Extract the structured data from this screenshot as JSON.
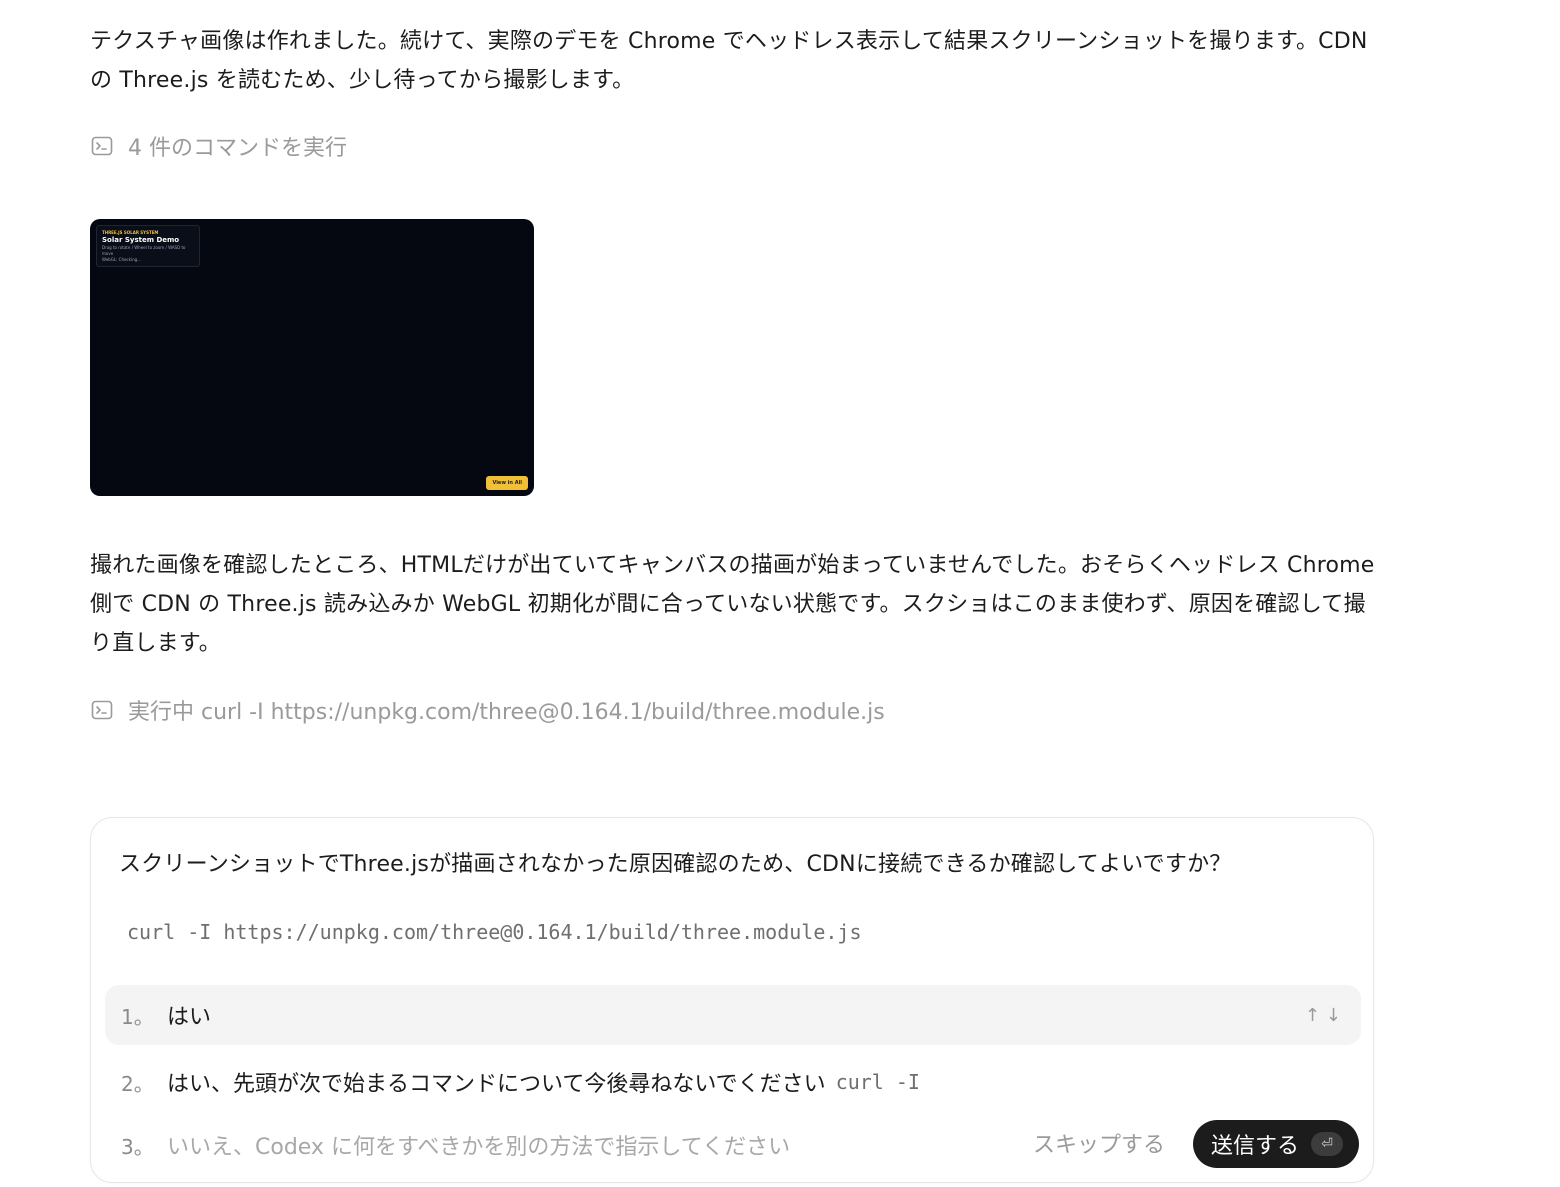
{
  "messages": {
    "para1": "テクスチャ画像は作れました。続けて、実際のデモを Chrome でヘッドレス表示して結果スクリーンショットを撮ります。CDN の Three.js を読むため、少し待ってから撮影します。",
    "command_summary": "4 件のコマンドを実行",
    "para2": "撮れた画像を確認したところ、HTMLだけが出ていてキャンバスの描画が始まっていませんでした。おそらくヘッドレス Chrome 側で CDN の Three.js 読み込みか WebGL 初期化が間に合っていない状態です。スクショはこのまま使わず、原因を確認して撮り直します。",
    "running_command": "実行中 curl -I https://unpkg.com/three@0.164.1/build/three.module.js"
  },
  "screenshot": {
    "kicker": "THREE.JS SOLAR SYSTEM",
    "title": "Solar System Demo",
    "subtitle": "Drag to rotate / Wheel to zoom / WASD to move",
    "status": "WebGL: Checking...",
    "button": "View in All"
  },
  "approval": {
    "question": "スクリーンショットでThree.jsが描画されなかった原因確認のため、CDNに接続できるか確認してよいですか？",
    "command": "curl -I https://unpkg.com/three@0.164.1/build/three.module.js",
    "options": [
      {
        "number": "1。",
        "label": "はい"
      },
      {
        "number": "2。",
        "label": "はい、先頭が次で始まるコマンドについて今後尋ねないでください",
        "code": "curl -I"
      },
      {
        "number": "3。",
        "label": "いいえ、Codex に何をすべきかを別の方法で指示してください"
      }
    ],
    "option_nav": "↑↓",
    "skip_label": "スキップする",
    "send_label": "送信する",
    "send_key": "⏎"
  },
  "icons": {
    "terminal": "terminal-icon",
    "arrow_up": "arrow-up-icon",
    "arrow_down": "arrow-down-icon",
    "enter": "enter-key-icon"
  }
}
